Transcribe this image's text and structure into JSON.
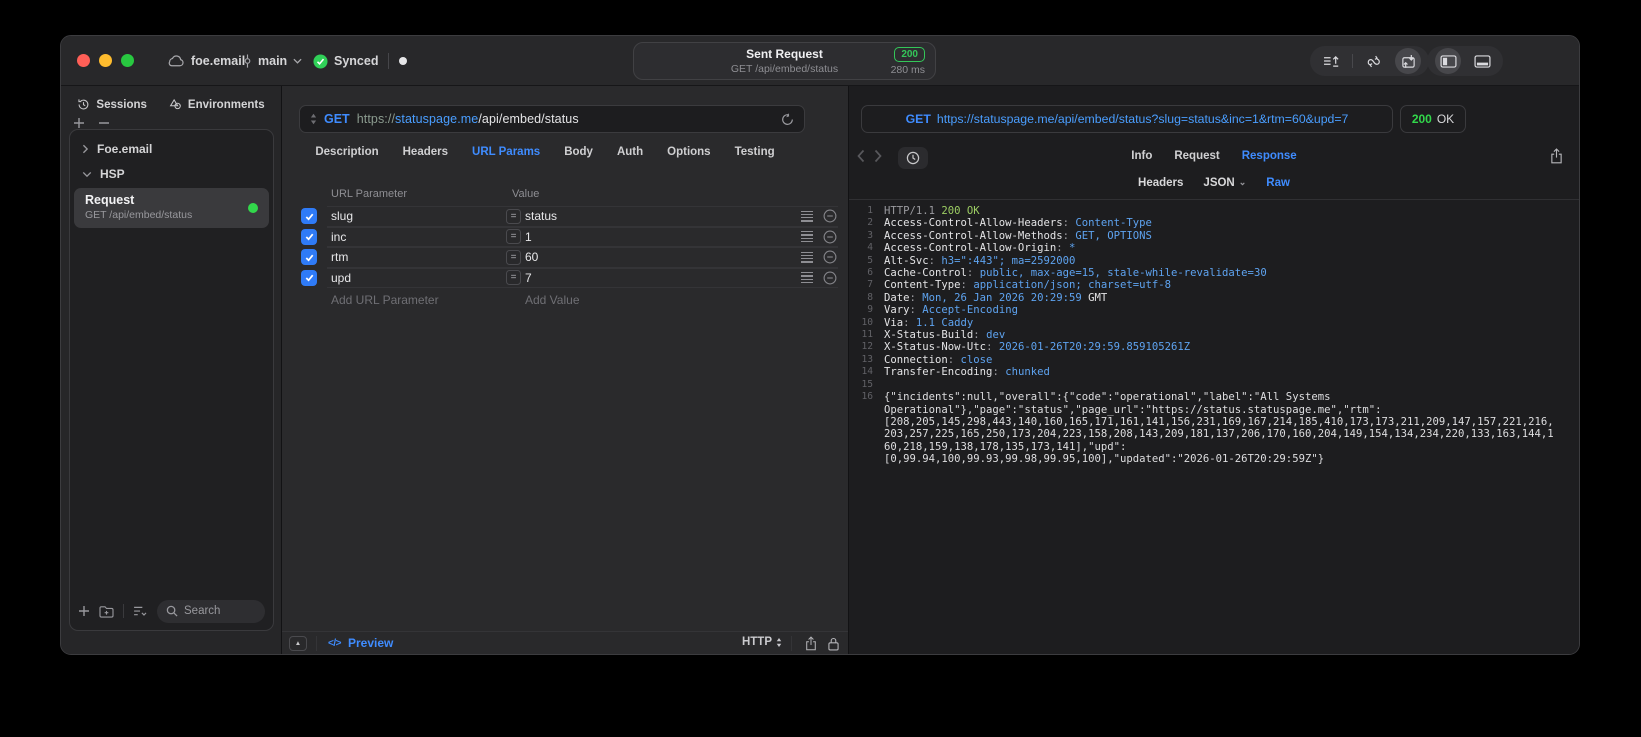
{
  "titlebar": {
    "project": "foe.email",
    "branch": "main",
    "sync_status": "Synced",
    "request_summary": {
      "title": "Sent Request",
      "subtitle": "GET /api/embed/status",
      "status_code": "200",
      "duration": "280 ms"
    }
  },
  "sidebar": {
    "tabs": [
      {
        "label": "Sessions",
        "icon": "history-icon"
      },
      {
        "label": "Environments",
        "icon": "environments-icon"
      }
    ],
    "tree": [
      {
        "label": "Foe.email",
        "state": "collapsed"
      },
      {
        "label": "HSP",
        "state": "expanded"
      }
    ],
    "request_item": {
      "title": "Request",
      "subtitle": "GET /api/embed/status"
    },
    "search_placeholder": "Search"
  },
  "request_panel": {
    "method": "GET",
    "url": {
      "scheme": "https://",
      "host": "statuspage.me",
      "path": "/api/embed/status"
    },
    "tabs": [
      "Description",
      "Headers",
      "URL Params",
      "Body",
      "Auth",
      "Options",
      "Testing"
    ],
    "active_tab": "URL Params",
    "params_table": {
      "columns": [
        "URL Parameter",
        "Value"
      ],
      "rows": [
        {
          "name": "slug",
          "value": "status",
          "enabled": true
        },
        {
          "name": "inc",
          "value": "1",
          "enabled": true
        },
        {
          "name": "rtm",
          "value": "60",
          "enabled": true
        },
        {
          "name": "upd",
          "value": "7",
          "enabled": true
        }
      ],
      "add_param_placeholder": "Add URL Parameter",
      "add_value_placeholder": "Add Value"
    },
    "footer": {
      "code_glyph": "</>",
      "preview_label": "Preview",
      "protocol": "HTTP"
    }
  },
  "response_panel": {
    "method": "GET",
    "url": "https://statuspage.me/api/embed/status?slug=status&inc=1&rtm=60&upd=7",
    "status_code": "200",
    "status_text": "OK",
    "tabs": [
      "Info",
      "Request",
      "Response"
    ],
    "active_tab": "Response",
    "subtabs": [
      "Headers",
      "JSON",
      "Raw"
    ],
    "active_subtab": "Raw",
    "body_lines": [
      {
        "n": "1",
        "parts": [
          {
            "t": "HTTP/1.1 ",
            "c": "dim"
          },
          {
            "t": "200 OK",
            "c": "green"
          }
        ]
      },
      {
        "n": "2",
        "parts": [
          {
            "t": "Access-Control-Allow-Headers",
            "c": "key"
          },
          {
            "t": ": ",
            "c": "dim"
          },
          {
            "t": "Content-Type",
            "c": "val"
          }
        ]
      },
      {
        "n": "3",
        "parts": [
          {
            "t": "Access-Control-Allow-Methods",
            "c": "key"
          },
          {
            "t": ": ",
            "c": "dim"
          },
          {
            "t": "GET, OPTIONS",
            "c": "val"
          }
        ]
      },
      {
        "n": "4",
        "parts": [
          {
            "t": "Access-Control-Allow-Origin",
            "c": "key"
          },
          {
            "t": ": ",
            "c": "dim"
          },
          {
            "t": "*",
            "c": "val"
          }
        ]
      },
      {
        "n": "5",
        "parts": [
          {
            "t": "Alt-Svc",
            "c": "key"
          },
          {
            "t": ": ",
            "c": "dim"
          },
          {
            "t": "h3=\":443\"; ma=2592000",
            "c": "val"
          }
        ]
      },
      {
        "n": "6",
        "parts": [
          {
            "t": "Cache-Control",
            "c": "key"
          },
          {
            "t": ": ",
            "c": "dim"
          },
          {
            "t": "public, max-age=15, stale-while-revalidate=30",
            "c": "val"
          }
        ]
      },
      {
        "n": "7",
        "parts": [
          {
            "t": "Content-Type",
            "c": "key"
          },
          {
            "t": ": ",
            "c": "dim"
          },
          {
            "t": "application/json; charset=utf-8",
            "c": "val"
          }
        ]
      },
      {
        "n": "8",
        "parts": [
          {
            "t": "Date",
            "c": "key"
          },
          {
            "t": ": ",
            "c": "dim"
          },
          {
            "t": "Mon, 26 Jan 2026 20:29:59 ",
            "c": "val"
          },
          {
            "t": "GMT",
            "c": "key"
          }
        ]
      },
      {
        "n": "9",
        "parts": [
          {
            "t": "Vary",
            "c": "key"
          },
          {
            "t": ": ",
            "c": "dim"
          },
          {
            "t": "Accept-Encoding",
            "c": "val"
          }
        ]
      },
      {
        "n": "10",
        "parts": [
          {
            "t": "Via",
            "c": "key"
          },
          {
            "t": ": ",
            "c": "dim"
          },
          {
            "t": "1.1 Caddy",
            "c": "val"
          }
        ]
      },
      {
        "n": "11",
        "parts": [
          {
            "t": "X-Status-Build",
            "c": "key"
          },
          {
            "t": ": ",
            "c": "dim"
          },
          {
            "t": "dev",
            "c": "val"
          }
        ]
      },
      {
        "n": "12",
        "parts": [
          {
            "t": "X-Status-Now-Utc",
            "c": "key"
          },
          {
            "t": ": ",
            "c": "dim"
          },
          {
            "t": "2026-01-26T20:29:59.859105261Z",
            "c": "val"
          }
        ]
      },
      {
        "n": "13",
        "parts": [
          {
            "t": "Connection",
            "c": "key"
          },
          {
            "t": ": ",
            "c": "dim"
          },
          {
            "t": "close",
            "c": "val"
          }
        ]
      },
      {
        "n": "14",
        "parts": [
          {
            "t": "Transfer-Encoding",
            "c": "key"
          },
          {
            "t": ": ",
            "c": "dim"
          },
          {
            "t": "chunked",
            "c": "val"
          }
        ]
      },
      {
        "n": "15",
        "parts": []
      },
      {
        "n": "16",
        "parts": [
          {
            "t": "{\"incidents\":null,\"overall\":{\"code\":\"operational\",\"label\":\"All Systems",
            "c": "plain"
          }
        ]
      },
      {
        "n": "",
        "parts": [
          {
            "t": "Operational\"},\"page\":\"status\",\"page_url\":\"https://status.statuspage.me\",\"rtm\":",
            "c": "plain"
          }
        ]
      },
      {
        "n": "",
        "parts": [
          {
            "t": "[208,205,145,298,443,140,160,165,171,161,141,156,231,169,167,214,185,410,173,173,211,209,147,157,221,216,",
            "c": "plain"
          }
        ]
      },
      {
        "n": "",
        "parts": [
          {
            "t": "203,257,225,165,250,173,204,223,158,208,143,209,181,137,206,170,160,204,149,154,134,234,220,133,163,144,1",
            "c": "plain"
          }
        ]
      },
      {
        "n": "",
        "parts": [
          {
            "t": "60,218,159,138,178,135,173,141],\"upd\":",
            "c": "plain"
          }
        ]
      },
      {
        "n": "",
        "parts": [
          {
            "t": "[0,99.94,100,99.93,99.98,99.95,100],\"updated\":\"2026-01-26T20:29:59Z\"}",
            "c": "plain"
          }
        ]
      }
    ]
  },
  "colors": {
    "accent_blue": "#3f8cff",
    "url_blue": "#4a9eff",
    "success_green": "#32d74b",
    "code_value_blue": "#5ea3f0",
    "code_status_green": "#9ccd63",
    "checkbox_blue": "#2f7bf7"
  },
  "icons": {
    "titlebar": [
      "cloud-icon",
      "git-commit-icon",
      "chevron-down-icon",
      "check-circle-icon",
      "export-lines-icon",
      "merge-loop-icon",
      "import-box-icon",
      "panel-left-icon",
      "panel-bottom-icon"
    ],
    "sidebar": [
      "history-icon",
      "environments-icon",
      "plus-icon",
      "minus-icon",
      "folder-add-icon",
      "list-filter-icon",
      "search-icon"
    ],
    "request_panel": [
      "method-updown-icon",
      "refresh-icon",
      "equals-badge",
      "row-menu-icon",
      "minus-circle-icon",
      "collapse-panel-icon",
      "code-icon",
      "share-icon",
      "lock-icon"
    ],
    "response_panel": [
      "back-chevron-icon",
      "forward-chevron-icon",
      "history-clock-icon",
      "share-icon",
      "chevron-down-icon"
    ]
  }
}
